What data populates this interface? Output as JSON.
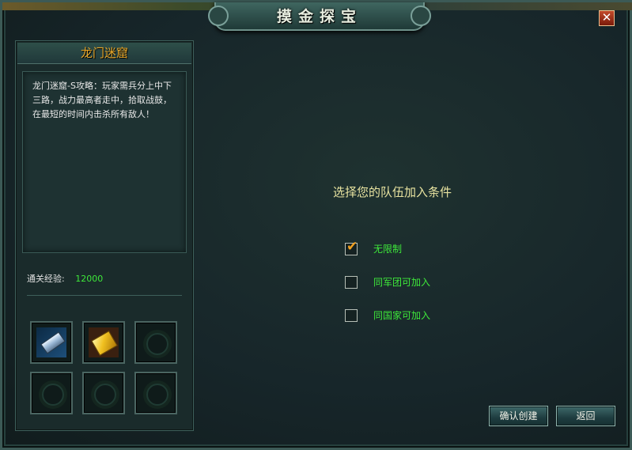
{
  "window": {
    "title": "摸金探宝"
  },
  "dungeon": {
    "name": "龙门迷窟",
    "description": "龙门迷窟-S攻略：玩家需兵分上中下三路，战力最高者走中，拾取战鼓，在最短的时间内击杀所有敌人！",
    "exp_label": "通关经验:",
    "exp_value": "12000"
  },
  "rewards": [
    {
      "icon": "steel-ingot-icon"
    },
    {
      "icon": "gold-bar-icon"
    },
    {
      "icon": "empty-slot-icon"
    },
    {
      "icon": "empty-slot-icon"
    },
    {
      "icon": "empty-slot-icon"
    },
    {
      "icon": "empty-slot-icon"
    }
  ],
  "join": {
    "prompt": "选择您的队伍加入条件",
    "options": [
      {
        "label": "无限制",
        "checked": true
      },
      {
        "label": "同军团可加入",
        "checked": false
      },
      {
        "label": "同国家可加入",
        "checked": false
      }
    ]
  },
  "buttons": {
    "confirm": "确认创建",
    "back": "返回"
  },
  "colors": {
    "accent_gold": "#e8a82a",
    "green_text": "#3ee83a",
    "check_orange": "#f0a020"
  }
}
